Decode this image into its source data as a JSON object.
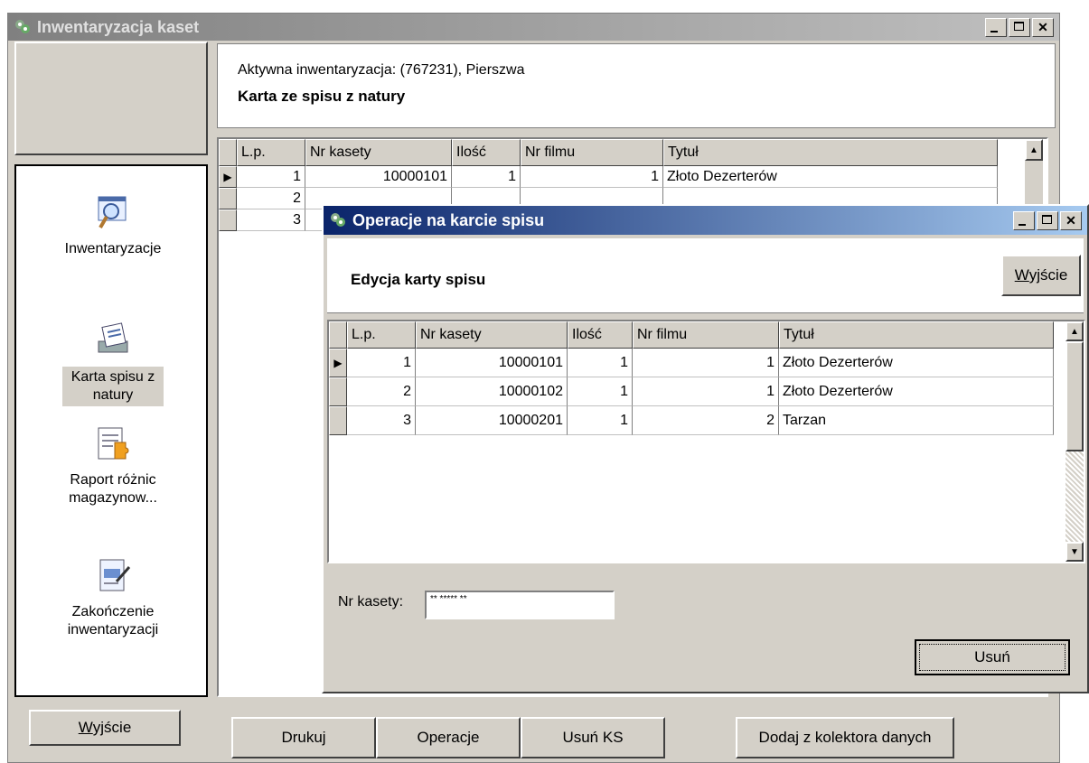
{
  "main_window": {
    "title": "Inwentaryzacja kaset",
    "active_inventory": "Aktywna inwentaryzacja: (767231), Pierszwa",
    "section_title": "Karta ze spisu z natury",
    "nav": [
      {
        "label": "Inwentaryzacje",
        "icon": "search-document-icon"
      },
      {
        "label": "Karta spisu z natury",
        "icon": "printer-document-icon"
      },
      {
        "label": "Raport różnic magazynow...",
        "icon": "puzzle-document-icon"
      },
      {
        "label": "Zakończenie inwentaryzacji",
        "icon": "edit-document-icon"
      }
    ],
    "exit_button": {
      "accel": "W",
      "rest": "yjście"
    },
    "grid": {
      "columns": [
        "L.p.",
        "Nr kasety",
        "Ilość",
        "Nr filmu",
        "Tytuł"
      ],
      "rows": [
        [
          "1",
          "10000101",
          "1",
          "1",
          "Złoto Dezerterów"
        ],
        [
          "2",
          "",
          "",
          "",
          ""
        ],
        [
          "3",
          "",
          "",
          "",
          ""
        ]
      ]
    },
    "buttons": {
      "print": "Drukuj",
      "operations": "Operacje",
      "delete_ks": "Usuń KS",
      "add_collector": "Dodaj z kolektora danych"
    }
  },
  "dialog": {
    "title": "Operacje na karcie spisu",
    "heading": "Edycja karty spisu",
    "exit_button": {
      "accel": "W",
      "rest": "yjście"
    },
    "grid": {
      "columns": [
        "L.p.",
        "Nr kasety",
        "Ilość",
        "Nr filmu",
        "Tytuł"
      ],
      "rows": [
        [
          "1",
          "10000101",
          "1",
          "1",
          "Złoto Dezerterów"
        ],
        [
          "2",
          "10000102",
          "1",
          "1",
          "Złoto Dezerterów"
        ],
        [
          "3",
          "10000201",
          "1",
          "2",
          "Tarzan"
        ]
      ]
    },
    "field_label": "Nr kasety:",
    "field_mask": "** ***** **",
    "delete_button": "Usuń"
  },
  "colors": {
    "dialog_titlebar": "#0a246a",
    "inactive_titlebar": "#808080",
    "face": "#d4d0c8"
  }
}
